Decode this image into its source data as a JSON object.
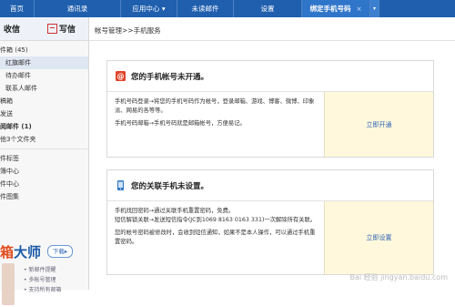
{
  "tabs": [
    {
      "label": "首页"
    },
    {
      "label": "通讯录"
    },
    {
      "label": "应用中心"
    },
    {
      "label": "未读邮件"
    },
    {
      "label": "设置"
    },
    {
      "label": "绑定手机号码",
      "close": "×"
    }
  ],
  "sidebar": {
    "receive": "收信",
    "write": "写信",
    "items": [
      {
        "label": "件箱 (45)"
      },
      {
        "label": "红旗邮件"
      },
      {
        "label": "待办邮件"
      },
      {
        "label": "联系人邮件"
      },
      {
        "label": "稿箱"
      },
      {
        "label": "发送"
      },
      {
        "label": "阅邮件 (1)"
      },
      {
        "label": "他3个文件夹"
      },
      {
        "label": "件标签"
      },
      {
        "label": "簿中心"
      },
      {
        "label": "件中心"
      },
      {
        "label": "件图集"
      }
    ],
    "promo": {
      "title_a": "箱",
      "title_b": "大师",
      "button": "下载",
      "features": [
        "新邮件提醒",
        "多帐号管理",
        "支持所有邮箱"
      ]
    }
  },
  "main": {
    "breadcrumb": "帐号管理>>手机服务",
    "cards": [
      {
        "title": "您的手机帐号未开通。",
        "paragraphs": [
          "手机号码登录→将您的手机号码作为帐号，登录邮箱、游戏、博客、微博、印象派、网易的各等等。",
          "手机号码邮箱→手机号码就是邮箱帐号，方便易记。"
        ],
        "action": "立即开通"
      },
      {
        "title": "您的关联手机未设置。",
        "paragraphs": [
          "手机找回密码→通过关联手机重置密码，免费。",
          "短信解锁关联→发送短信指令(JC到1069 8163 0163 331)一次解除所有关联。",
          "您的帐号密码被修改时，会收到短信通知，如果不是本人操作，可以通过手机重置密码。"
        ],
        "action": "立即设置"
      }
    ]
  },
  "watermark": "Bai 经验 jingyan.baidu.com"
}
